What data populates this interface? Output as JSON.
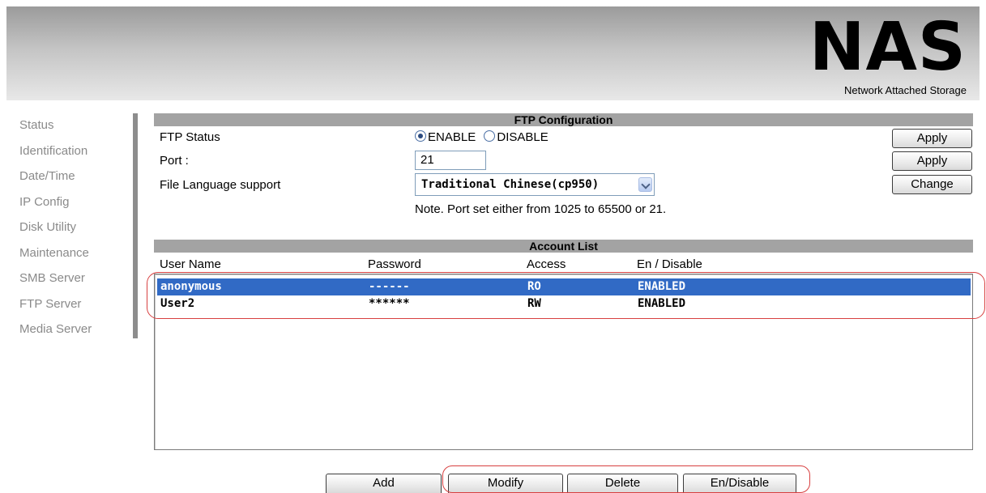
{
  "header": {
    "logo_title": "NAS",
    "logo_subtitle": "Network Attached Storage"
  },
  "sidebar": {
    "items": [
      {
        "label": "Status"
      },
      {
        "label": "Identification"
      },
      {
        "label": "Date/Time"
      },
      {
        "label": "IP Config"
      },
      {
        "label": "Disk Utility"
      },
      {
        "label": "Maintenance"
      },
      {
        "label": "SMB Server"
      },
      {
        "label": "FTP Server"
      },
      {
        "label": "Media Server"
      }
    ]
  },
  "ftp_config": {
    "title": "FTP Configuration",
    "status_label": "FTP Status",
    "enable_label": "ENABLE",
    "disable_label": "DISABLE",
    "status_selected": "ENABLE",
    "port_label": "Port :",
    "port_value": "21",
    "language_label": "File Language support",
    "language_value": "Traditional Chinese(cp950)",
    "note": "Note. Port set either from 1025 to 65500 or 21.",
    "apply_status_label": "Apply",
    "apply_port_label": "Apply",
    "change_label": "Change"
  },
  "account_list": {
    "title": "Account List",
    "columns": [
      "User Name",
      "Password",
      "Access",
      "En / Disable"
    ],
    "rows": [
      {
        "user": "anonymous",
        "password": "------",
        "access": "RO",
        "status": "ENABLED",
        "selected": true
      },
      {
        "user": "User2",
        "password": "******",
        "access": "RW",
        "status": "ENABLED",
        "selected": false
      }
    ]
  },
  "actions": {
    "add_label": "Add",
    "modify_label": "Modify",
    "delete_label": "Delete",
    "endisable_label": "En/Disable"
  },
  "colors": {
    "selection": "#316ac5",
    "section_bar": "#a3a3a3",
    "highlight": "#d84040"
  }
}
